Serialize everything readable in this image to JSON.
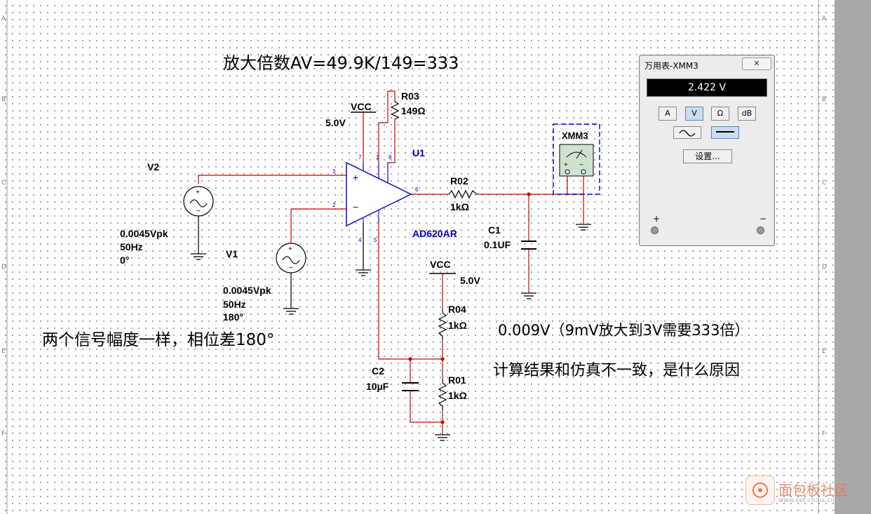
{
  "annotations": {
    "gain_note": "放大倍数AV=49.9K/149=333",
    "phase_note": "两个信号幅度一样，相位差180°",
    "result_note": "0.009V（9mV放大到3V需要333倍）",
    "question_note": "计算结果和仿真不一致，是什么原因"
  },
  "components": {
    "u1": {
      "ref": "U1",
      "part": "AD620AR",
      "pins": [
        "3",
        "2",
        "6",
        "7",
        "4",
        "1",
        "8",
        "5"
      ]
    },
    "vcc_top": {
      "label": "VCC",
      "voltage": "5.0V"
    },
    "vcc_bottom": {
      "label": "VCC",
      "voltage": "5.0V"
    },
    "r03": {
      "ref": "R03",
      "value": "149Ω"
    },
    "r02": {
      "ref": "R02",
      "value": "1kΩ"
    },
    "r04": {
      "ref": "R04",
      "value": "1kΩ"
    },
    "r01": {
      "ref": "R01",
      "value": "1kΩ"
    },
    "c1": {
      "ref": "C1",
      "value": "0.1UF"
    },
    "c2": {
      "ref": "C2",
      "value": "10µF"
    },
    "v2": {
      "ref": "V2",
      "amplitude": "0.0045Vpk",
      "frequency": "50Hz",
      "phase": "0°"
    },
    "v1": {
      "ref": "V1",
      "amplitude": "0.0045Vpk",
      "frequency": "50Hz",
      "phase": "180°"
    },
    "xmm3": {
      "ref": "XMM3"
    }
  },
  "multimeter": {
    "title": "万用表-XMM3",
    "close_label": "✕",
    "reading": "2.422 V",
    "modes": [
      "A",
      "V",
      "Ω",
      "dB"
    ],
    "active_mode": "V",
    "settings_label": "设置...",
    "plus_label": "+",
    "minus_label": "−"
  },
  "rulers": {
    "left": [
      "A",
      "B",
      "C",
      "D",
      "E",
      "F"
    ],
    "right": [
      "A",
      "B",
      "C",
      "D",
      "E",
      "F"
    ]
  },
  "watermark": {
    "text": "面包板社区",
    "sub": "www.eet-china.com"
  },
  "colors": {
    "wire": "#cc0000",
    "part": "#000000",
    "label_blue": "#0000cc",
    "meter_box": "#0000cc"
  }
}
